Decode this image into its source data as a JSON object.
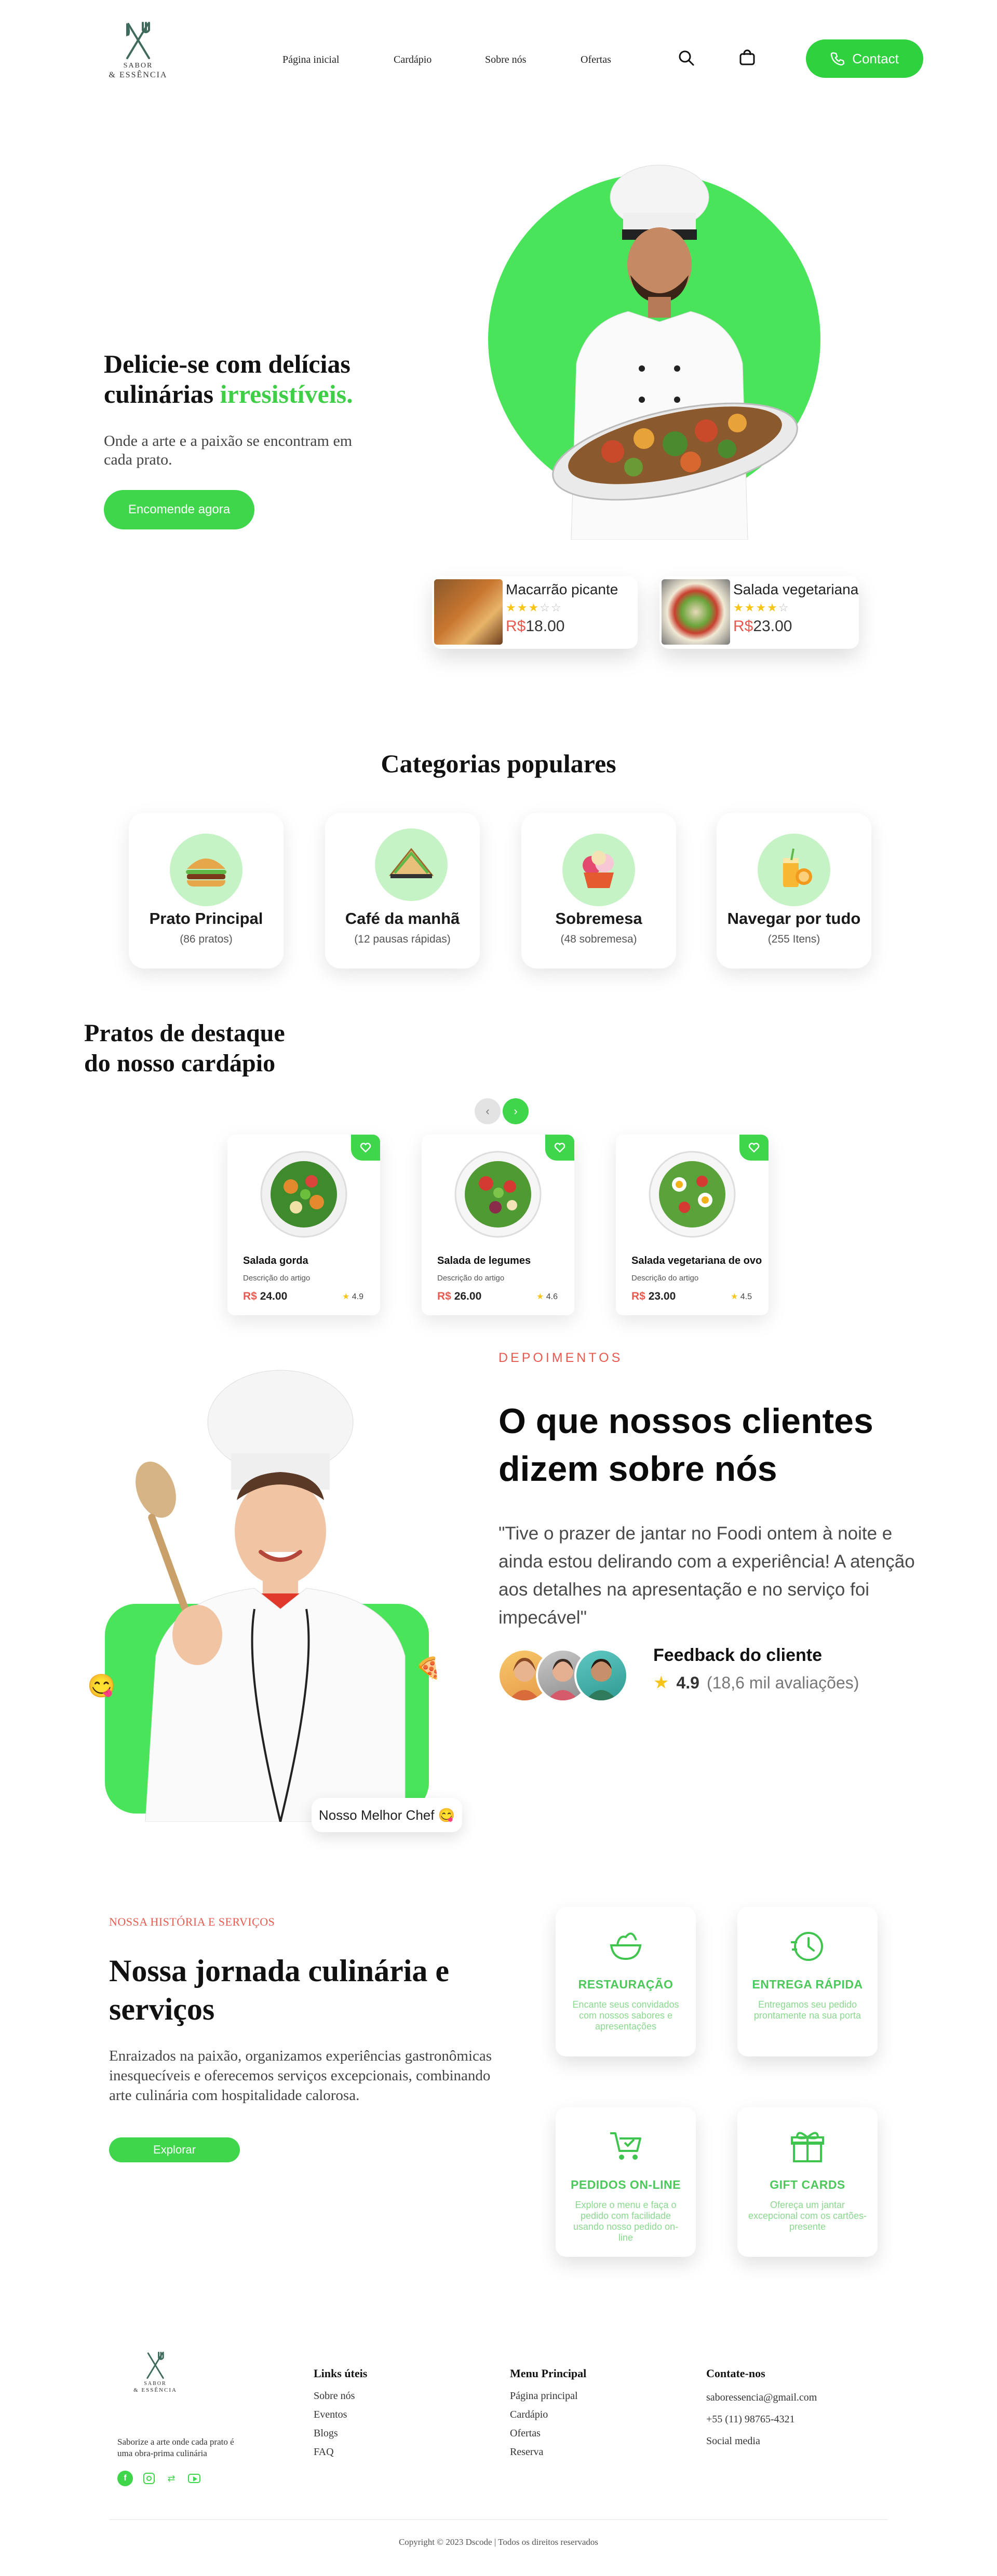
{
  "brand": {
    "line1": "SABOR",
    "line2": "& ESSÊNCIA",
    "icon": "fork-knife-icon"
  },
  "nav": {
    "home": "Página inicial",
    "menu": "Cardápio",
    "about": "Sobre nós",
    "offers": "Ofertas"
  },
  "header": {
    "search_icon": "search-icon",
    "cart_icon": "shopping-bag-icon",
    "contact_label": "Contact",
    "contact_icon": "phone-icon"
  },
  "hero": {
    "title_part1": "Delicie-se com delícias culinárias ",
    "title_accent": "irresistíveis.",
    "subtitle": "Onde a arte e a paixão se encontram em cada prato.",
    "cta": "Encomende agora",
    "cards": [
      {
        "name": "Macarrão picante",
        "rating": 3,
        "currency": "R$",
        "price": "18.00"
      },
      {
        "name": "Salada vegetariana",
        "rating": 4,
        "currency": "R$",
        "price": "23.00"
      }
    ]
  },
  "categories": {
    "title": "Categorias populares",
    "items": [
      {
        "name": "Prato Principal",
        "count": "(86 pratos)",
        "icon": "burger-icon"
      },
      {
        "name": "Café da manhã",
        "count": "(12 pausas rápidas)",
        "icon": "sandwich-icon"
      },
      {
        "name": "Sobremesa",
        "count": "(48 sobremesa)",
        "icon": "dessert-icon"
      },
      {
        "name": "Navegar por tudo",
        "count": "(255 Itens)",
        "icon": "drink-icon"
      }
    ]
  },
  "featured": {
    "title_line1": "Pratos de destaque",
    "title_line2": "do nosso cardápio",
    "prev_label": "‹",
    "next_label": "›",
    "dishes": [
      {
        "name": "Salada gorda",
        "desc": "Descrição do artigo",
        "currency": "R$",
        "price": "24.00",
        "rating": "4.9"
      },
      {
        "name": "Salada de legumes",
        "desc": "Descrição do artigo",
        "currency": "R$",
        "price": "26.00",
        "rating": "4.6"
      },
      {
        "name": "Salada vegetariana de ovo",
        "desc": "Descrição do artigo",
        "currency": "R$",
        "price": "23.00",
        "rating": "4.5"
      }
    ]
  },
  "testimonials": {
    "eyebrow": "DEPOIMENTOS",
    "title": "O que nossos clientes dizem sobre nós",
    "quote": "\"Tive o prazer de jantar no Foodi ontem à noite e ainda estou delirando com a experiência! A atenção aos detalhes na apresentação e no serviço foi impecável\"",
    "feedback_label": "Feedback do cliente",
    "rating": "4.9",
    "reviews": "(18,6 mil avaliações)",
    "chef_badge": "Nosso Melhor Chef 😋"
  },
  "services": {
    "eyebrow": "NOSSA HISTÓRIA E SERVIÇOS",
    "title": "Nossa jornada culinária e serviços",
    "text": "Enraizados na paixão, organizamos experiências gastronômicas inesquecíveis e oferecemos serviços excepcionais, combinando arte culinária com hospitalidade calorosa.",
    "cta": "Explorar",
    "items": [
      {
        "title": "RESTAURAÇÃO",
        "desc": "Encante seus convidados com nossos sabores e apresentações",
        "icon": "salad-bowl-icon"
      },
      {
        "title": "ENTREGA RÁPIDA",
        "desc": "Entregamos seu pedido prontamente na sua porta",
        "icon": "fast-clock-icon"
      },
      {
        "title": "PEDIDOS ON-LINE",
        "desc": "Explore o menu e faça o pedido com facilidade usando nosso pedido on-line",
        "icon": "cart-check-icon"
      },
      {
        "title": "GIFT CARDS",
        "desc": "Ofereça um jantar excepcional com os cartões-presente",
        "icon": "gift-icon"
      }
    ]
  },
  "footer": {
    "tagline": "Saborize a arte onde cada prato é uma obra-prima culinária",
    "col1_title": "Links úteis",
    "col1": [
      "Sobre nós",
      "Eventos",
      "Blogs",
      "FAQ"
    ],
    "col2_title": "Menu Principal",
    "col2": [
      "Página principal",
      "Cardápio",
      "Ofertas",
      "Reserva"
    ],
    "col3_title": "Contate-nos",
    "email": "saboressencia@gmail.com",
    "phone": "+55 (11) 98765-4321",
    "social": "Social media",
    "copyright": "Copyright © 2023 Dscode | Todos os direitos reservados",
    "social_icons": [
      "facebook-icon",
      "instagram-icon",
      "twitter-icon",
      "youtube-icon"
    ]
  },
  "colors": {
    "accent": "#3fd64b",
    "price": "#e85a4f",
    "star": "#f7c51a"
  }
}
